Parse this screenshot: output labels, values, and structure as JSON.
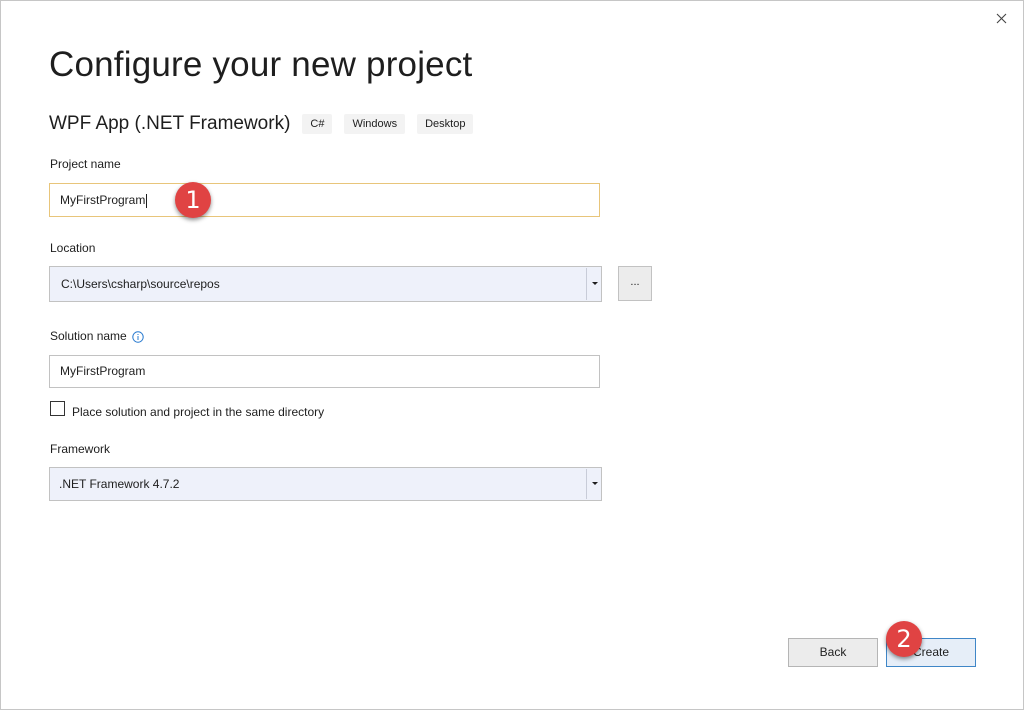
{
  "window": {
    "close_icon": "close-icon"
  },
  "header": {
    "title": "Configure your new project",
    "template_name": "WPF App (.NET Framework)",
    "tags": [
      "C#",
      "Windows",
      "Desktop"
    ]
  },
  "form": {
    "project_name": {
      "label": "Project name",
      "value": "MyFirstProgram"
    },
    "location": {
      "label": "Location",
      "value": "C:\\Users\\csharp\\source\\repos",
      "browse_label": "..."
    },
    "solution_name": {
      "label": "Solution name",
      "value": "MyFirstProgram",
      "info_icon": "info-icon"
    },
    "same_directory": {
      "label": "Place solution and project in the same directory",
      "checked": false
    },
    "framework": {
      "label": "Framework",
      "value": ".NET Framework 4.7.2"
    }
  },
  "footer": {
    "back_label": "Back",
    "create_label": "Create"
  },
  "annotations": {
    "badge_1": "1",
    "badge_2": "2",
    "color": "#e04343"
  },
  "colors": {
    "focus_border": "#e8c57a",
    "combo_background": "#eef1fa",
    "primary_border": "#3f86c7"
  }
}
